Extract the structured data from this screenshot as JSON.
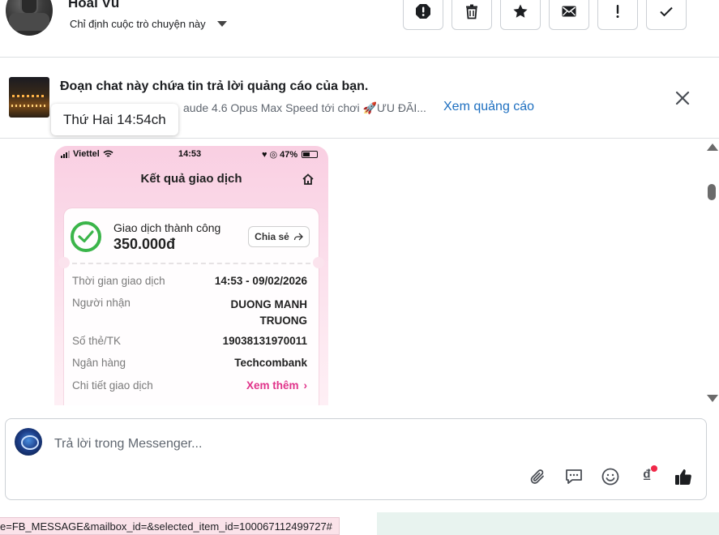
{
  "header": {
    "contact_name": "Hoài Vũ",
    "assign_label": "Chỉ định cuộc trò chuyện này",
    "actions": [
      {
        "name": "spam-button",
        "icon": "exclamation-circle-icon"
      },
      {
        "name": "delete-button",
        "icon": "trash-icon"
      },
      {
        "name": "star-button",
        "icon": "star-icon"
      },
      {
        "name": "mark-unread-button",
        "icon": "envelope-icon"
      },
      {
        "name": "follow-up-button",
        "icon": "exclamation-icon"
      },
      {
        "name": "mark-done-button",
        "icon": "checkmark-icon"
      }
    ]
  },
  "ad_banner": {
    "title": "Đoạn chat này chứa tin trả lời quảng cáo của bạn.",
    "subtitle": "aude 4.6 Opus Max Speed tới chơi 🚀ƯU ĐÃI...",
    "link_label": "Xem quảng cáo"
  },
  "tooltip": {
    "text": "Thứ Hai 14:54ch"
  },
  "receipt": {
    "carrier": "Viettel",
    "time": "14:53",
    "battery": "47%",
    "screen_title": "Kết quả giao dịch",
    "status_label": "Giao dịch thành công",
    "amount": "350.000đ",
    "share_label": "Chia sẻ",
    "rows": {
      "time_key": "Thời gian giao dịch",
      "time_val": "14:53 - 09/02/2026",
      "recipient_key": "Người nhận",
      "recipient_val": "DUONG MANH TRUONG",
      "account_key": "Số thẻ/TK",
      "account_val": "19038131970011",
      "bank_key": "Ngân hàng",
      "bank_val": "Techcombank",
      "detail_key": "Chi tiết giao dịch",
      "detail_val": "Xem thêm"
    }
  },
  "composer": {
    "placeholder": "Trả lời trong Messenger...",
    "tools": [
      "paperclip-icon",
      "saved-reply-icon",
      "emoji-icon",
      "payment-dong-icon",
      "thumbs-up-icon"
    ],
    "dong_symbol": "₫"
  },
  "status_url": "e=FB_MESSAGE&mailbox_id=&selected_item_id=100067112499727#",
  "colors": {
    "link_blue": "#1d6fc0",
    "success_green": "#3bb54a",
    "pink_accent": "#e0338a",
    "notification_red": "#f02849"
  }
}
